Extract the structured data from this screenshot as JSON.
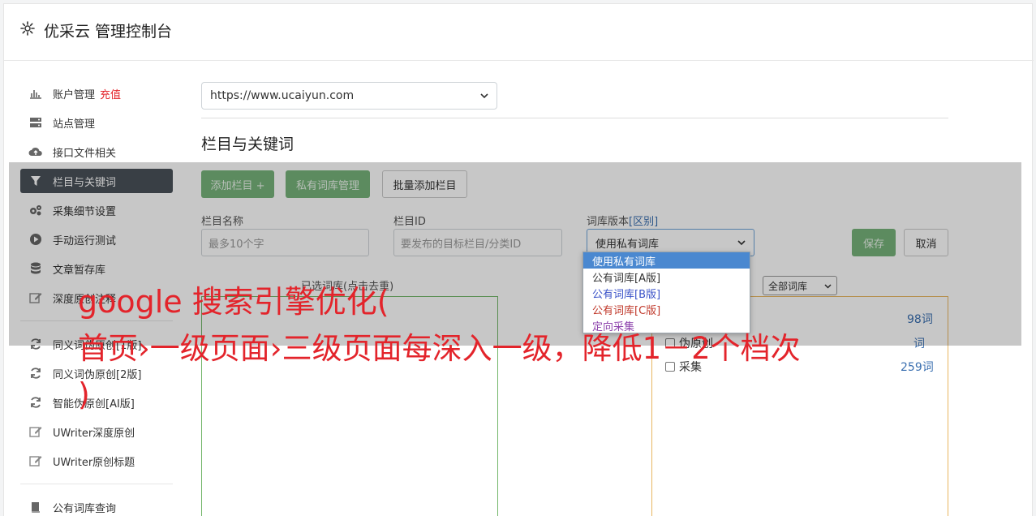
{
  "header": {
    "title": "优采云 管理控制台",
    "icon": "gear-icon"
  },
  "sidebar": {
    "items": [
      {
        "label": "账户管理",
        "icon": "bar-chart-icon",
        "extra": "充值"
      },
      {
        "label": "站点管理",
        "icon": "server-icon"
      },
      {
        "label": "接口文件相关",
        "icon": "cloud-upload-icon"
      },
      {
        "label": "栏目与关键词",
        "icon": "filter-icon",
        "active": true
      },
      {
        "label": "采集细节设置",
        "icon": "cogs-icon"
      },
      {
        "label": "手动运行测试",
        "icon": "play-circle-icon"
      },
      {
        "label": "文章暂存库",
        "icon": "database-icon"
      },
      {
        "label": "深度原创注释",
        "icon": "edit-icon"
      },
      {
        "label": "同义词伪原创[1版]",
        "icon": "refresh-icon"
      },
      {
        "label": "同义词伪原创[2版]",
        "icon": "refresh-icon"
      },
      {
        "label": "智能伪原创[AI版]",
        "icon": "refresh-icon"
      },
      {
        "label": "UWriter深度原创",
        "icon": "edit-icon"
      },
      {
        "label": "UWriter原创标题",
        "icon": "edit-icon"
      },
      {
        "label": "公有词库查询",
        "icon": "book-icon"
      }
    ]
  },
  "main": {
    "site_select": "https://www.ucaiyun.com",
    "section_title": "栏目与关键词",
    "buttons": {
      "add_column": "添加栏目 +",
      "private_lib": "私有词库管理",
      "batch_add": "批量添加栏目",
      "save": "保存",
      "cancel": "取消"
    },
    "form": {
      "name_label": "栏目名称",
      "name_placeholder": "最多10个字",
      "id_label": "栏目ID",
      "id_placeholder": "要发布的目标栏目/分类ID",
      "version_label": "词库版本",
      "version_hint": "[区别]",
      "version_value": "使用私有词库"
    },
    "dropdown_options": [
      "使用私有词库",
      "公有词库[A版]",
      "公有词库[B版]",
      "公有词库[C版]",
      "定向采集"
    ],
    "left_panel_caption": "已选词库(点击去重)",
    "right_filter": "全部词库",
    "right_rows": [
      {
        "label": "",
        "count": "98词"
      },
      {
        "label": "伪原创",
        "count": "词"
      },
      {
        "label": "采集",
        "count": "259词"
      }
    ]
  },
  "watermark": {
    "line1": "google 搜索引擎优化(",
    "line2": "首页›一级页面›三级页面每深入一级，降低1－2个档次",
    "line3": ")"
  }
}
